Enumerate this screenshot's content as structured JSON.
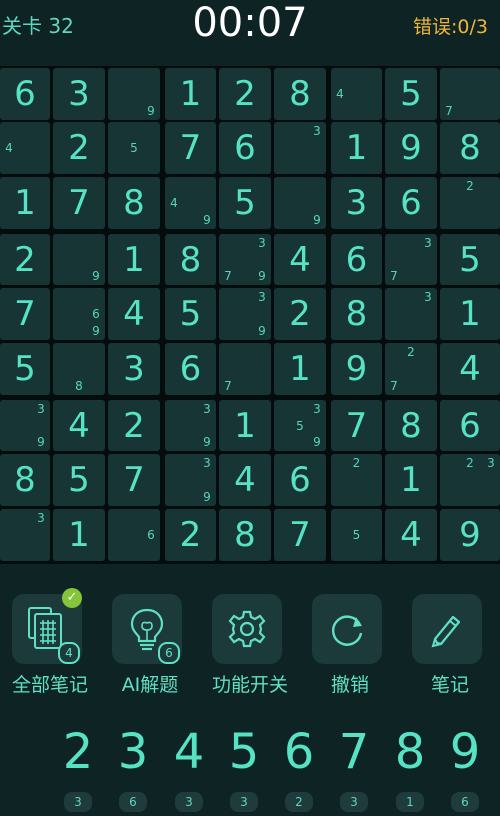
{
  "header": {
    "level": "关卡 32",
    "timer": "00:07",
    "errors": "错误:0/3"
  },
  "board": [
    [
      {
        "v": "6"
      },
      {
        "v": "3"
      },
      {
        "n": [
          "9"
        ]
      },
      {
        "v": "1"
      },
      {
        "v": "2"
      },
      {
        "v": "8"
      },
      {
        "n": [
          "4"
        ]
      },
      {
        "v": "5"
      },
      {
        "n": [
          "7"
        ]
      }
    ],
    [
      {
        "n": [
          "4"
        ]
      },
      {
        "v": "2"
      },
      {
        "n": [
          "5"
        ]
      },
      {
        "v": "7"
      },
      {
        "v": "6"
      },
      {
        "n": [
          "3"
        ]
      },
      {
        "v": "1"
      },
      {
        "v": "9"
      },
      {
        "v": "8"
      }
    ],
    [
      {
        "v": "1"
      },
      {
        "v": "7"
      },
      {
        "v": "8"
      },
      {
        "n": [
          "4",
          "9"
        ]
      },
      {
        "v": "5"
      },
      {
        "n": [
          "9"
        ]
      },
      {
        "v": "3"
      },
      {
        "v": "6"
      },
      {
        "n": [
          "2"
        ]
      }
    ],
    [
      {
        "v": "2"
      },
      {
        "n": [
          "9"
        ]
      },
      {
        "v": "1"
      },
      {
        "v": "8"
      },
      {
        "n": [
          "3",
          "7",
          "9"
        ]
      },
      {
        "v": "4"
      },
      {
        "v": "6"
      },
      {
        "n": [
          "3",
          "7"
        ]
      },
      {
        "v": "5"
      }
    ],
    [
      {
        "v": "7"
      },
      {
        "n": [
          "6",
          "9"
        ]
      },
      {
        "v": "4"
      },
      {
        "v": "5"
      },
      {
        "n": [
          "3",
          "9"
        ]
      },
      {
        "v": "2"
      },
      {
        "v": "8"
      },
      {
        "n": [
          "3"
        ]
      },
      {
        "v": "1"
      }
    ],
    [
      {
        "v": "5"
      },
      {
        "n": [
          "8"
        ]
      },
      {
        "v": "3"
      },
      {
        "v": "6"
      },
      {
        "n": [
          "7"
        ]
      },
      {
        "v": "1"
      },
      {
        "v": "9"
      },
      {
        "n": [
          "2",
          "7"
        ]
      },
      {
        "v": "4"
      }
    ],
    [
      {
        "n": [
          "3",
          "9"
        ]
      },
      {
        "v": "4"
      },
      {
        "v": "2"
      },
      {
        "n": [
          "3",
          "9"
        ]
      },
      {
        "v": "1"
      },
      {
        "n": [
          "3",
          "5",
          "9"
        ]
      },
      {
        "v": "7"
      },
      {
        "v": "8"
      },
      {
        "v": "6"
      }
    ],
    [
      {
        "v": "8"
      },
      {
        "v": "5"
      },
      {
        "v": "7"
      },
      {
        "n": [
          "3",
          "9"
        ]
      },
      {
        "v": "4"
      },
      {
        "v": "6"
      },
      {
        "n": [
          "2"
        ]
      },
      {
        "v": "1"
      },
      {
        "n": [
          "2",
          "3"
        ]
      }
    ],
    [
      {
        "n": [
          "3"
        ]
      },
      {
        "v": "1"
      },
      {
        "n": [
          "6"
        ]
      },
      {
        "v": "2"
      },
      {
        "v": "8"
      },
      {
        "v": "7"
      },
      {
        "n": [
          "5"
        ]
      },
      {
        "v": "4"
      },
      {
        "v": "9"
      }
    ]
  ],
  "tools": [
    {
      "label": "全部笔记",
      "icon": "all-notes-icon",
      "badge": "4",
      "check": "✓"
    },
    {
      "label": "AI解题",
      "icon": "lightbulb-icon",
      "badge": "6"
    },
    {
      "label": "功能开关",
      "icon": "gear-icon"
    },
    {
      "label": "撤销",
      "icon": "undo-icon"
    },
    {
      "label": "笔记",
      "icon": "pencil-icon"
    }
  ],
  "numpad": [
    {
      "digit": "2",
      "count": "3"
    },
    {
      "digit": "3",
      "count": "6"
    },
    {
      "digit": "4",
      "count": "3"
    },
    {
      "digit": "5",
      "count": "3"
    },
    {
      "digit": "6",
      "count": "2"
    },
    {
      "digit": "7",
      "count": "3"
    },
    {
      "digit": "8",
      "count": "1"
    },
    {
      "digit": "9",
      "count": "6"
    }
  ],
  "colors": {
    "background": "#0e2324",
    "cell": "#183535",
    "digit": "#55e3c3",
    "errors": "#f0b43a",
    "check": "#86c43a"
  }
}
